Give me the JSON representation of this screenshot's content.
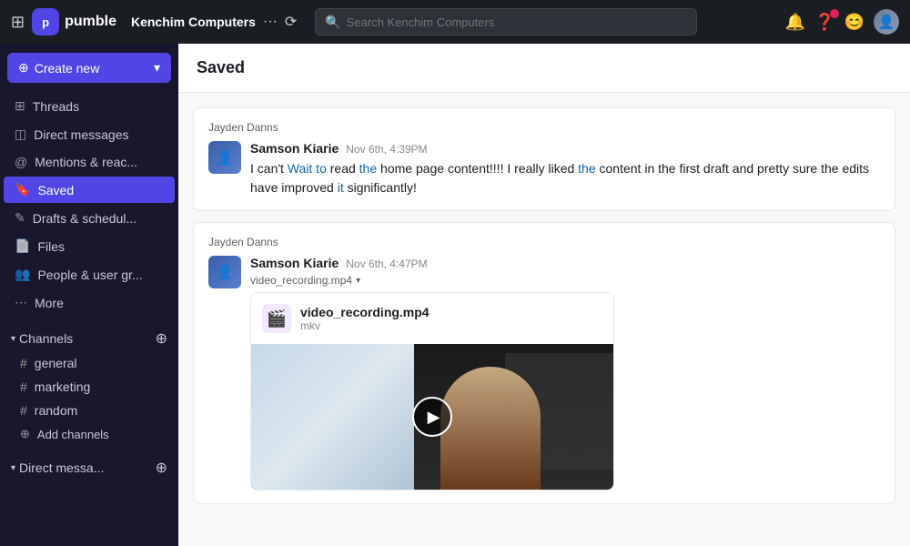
{
  "topbar": {
    "app_name": "pumble",
    "workspace": "Kenchim Computers",
    "search_placeholder": "Search Kenchim Computers"
  },
  "sidebar": {
    "create_new_label": "Create new",
    "nav_items": [
      {
        "id": "threads",
        "label": "Threads",
        "icon": "⊞"
      },
      {
        "id": "direct-messages",
        "label": "Direct messages",
        "icon": "◫"
      },
      {
        "id": "mentions",
        "label": "Mentions & reac...",
        "icon": "◎"
      },
      {
        "id": "saved",
        "label": "Saved",
        "icon": "🔖"
      },
      {
        "id": "drafts",
        "label": "Drafts & schedul...",
        "icon": "✎"
      },
      {
        "id": "files",
        "label": "Files",
        "icon": "⬜"
      },
      {
        "id": "people",
        "label": "People & user gr...",
        "icon": "◉"
      },
      {
        "id": "more",
        "label": "More",
        "icon": "⋯"
      }
    ],
    "channels_section": "Channels",
    "channels": [
      {
        "name": "general"
      },
      {
        "name": "marketing"
      },
      {
        "name": "random"
      }
    ],
    "add_channel_label": "Add channels",
    "direct_messages_section": "Direct messa..."
  },
  "content": {
    "page_title": "Saved",
    "messages": [
      {
        "sender_label": "Jayden Danns",
        "author": "Samson Kiarie",
        "time": "Nov 6th, 4:39PM",
        "text_before": "I can't ",
        "text_highlight1": "Wait to",
        "text_middle1": " read ",
        "text_highlight2": "the",
        "text_middle2": " home page content!!!! I really liked ",
        "text_highlight3": "the",
        "text_middle3": " content in the first draft and pretty sure the edits have improved ",
        "text_highlight4": "it",
        "text_end": " significantly!",
        "full_text": "I can't Wait to read the home page content!!!! I really liked the content in the first draft and pretty sure the edits have improved it significantly!"
      },
      {
        "sender_label": "Jayden Danns",
        "author": "Samson Kiarie",
        "time": "Nov 6th, 4:47PM",
        "attachment_name": "video_recording.mp4",
        "attachment_type": "mkv",
        "file_label": "video_recording.mp4"
      }
    ]
  }
}
